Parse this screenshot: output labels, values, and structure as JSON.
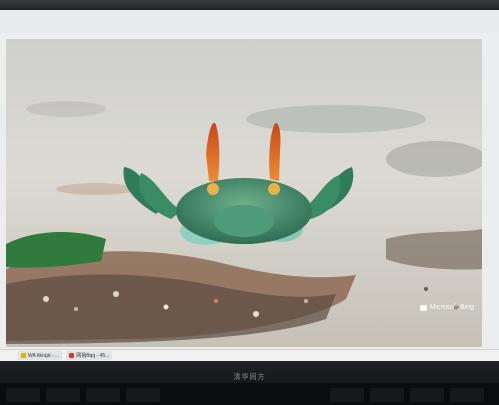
{
  "taskbar": {
    "items": [
      {
        "label": "WA tikrupt - ...",
        "icon": "folder-icon",
        "color": "#e2b400"
      },
      {
        "label": "网易Bqq - 45...",
        "icon": "app-icon",
        "color": "#d13a2a"
      }
    ]
  },
  "watermark": {
    "label": "Microsoft Bing"
  },
  "bezel": {
    "brand": "清华同方"
  },
  "colors": {
    "sand": "#d9d6cf",
    "crab": "#3f8a6a",
    "eyestalk": "#e0561f"
  }
}
